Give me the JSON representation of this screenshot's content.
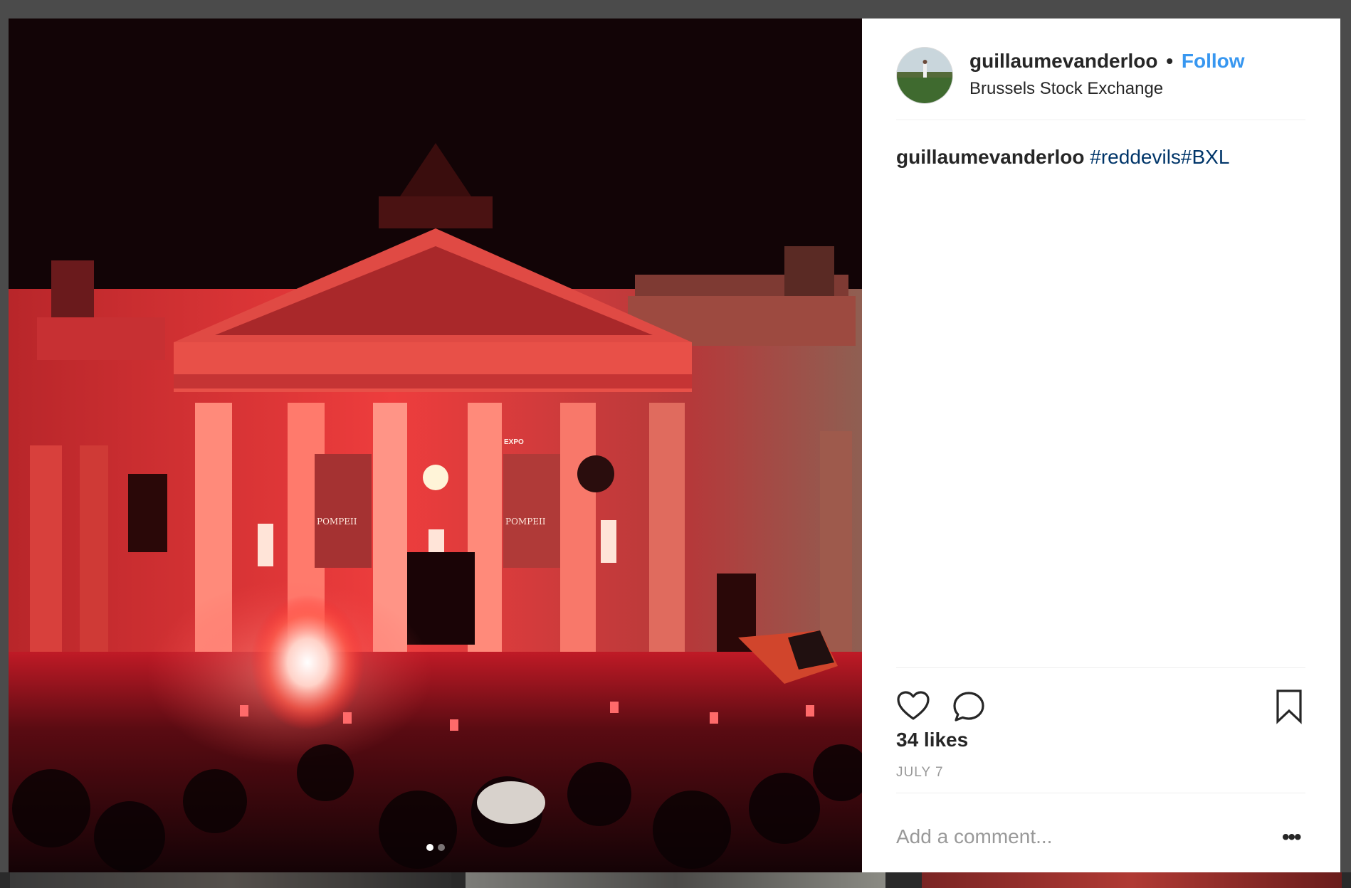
{
  "post": {
    "image_alt": "Crowd with red flares in front of the Brussels Stock Exchange at night",
    "carousel": {
      "count": 2,
      "active": 0
    },
    "banners": [
      "POMPEII",
      "POMPEII"
    ],
    "expo_sign": "EXPO"
  },
  "header": {
    "username": "guillaumevanderloo",
    "separator": "•",
    "follow_label": "Follow",
    "location": "Brussels Stock Exchange",
    "avatar_icon": "avatar-icon"
  },
  "caption": {
    "author": "guillaumevanderloo",
    "tags": "#reddevils#BXL"
  },
  "actions": {
    "like_icon": "heart-icon",
    "comment_icon": "comment-icon",
    "save_icon": "bookmark-icon",
    "likes": "34 likes",
    "date": "JULY 7"
  },
  "comment": {
    "placeholder": "Add a comment...",
    "more_label": "•••"
  },
  "colors": {
    "follow": "#3897f0",
    "hashtag": "#003569",
    "muted": "#999999",
    "text": "#262626"
  }
}
